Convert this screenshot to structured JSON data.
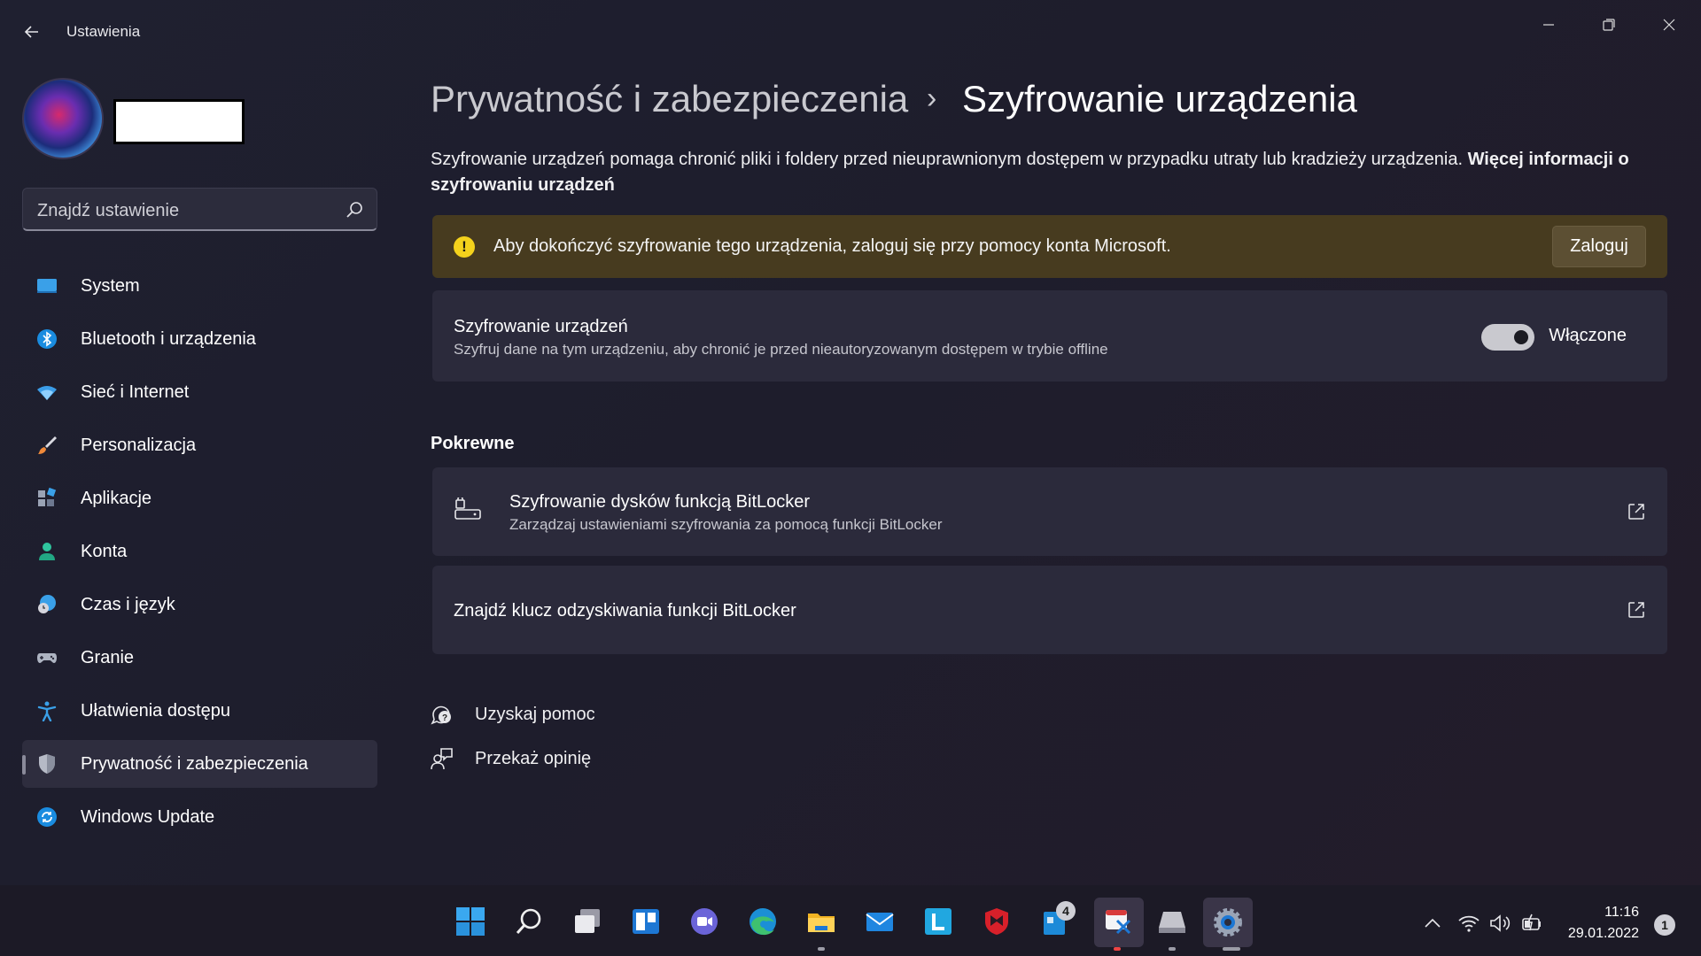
{
  "window": {
    "title": "Ustawienia"
  },
  "sidebar": {
    "search_placeholder": "Znajdź ustawienie",
    "items": [
      {
        "label": "System",
        "icon": "monitor-icon"
      },
      {
        "label": "Bluetooth i urządzenia",
        "icon": "bluetooth-icon"
      },
      {
        "label": "Sieć i Internet",
        "icon": "wifi-icon"
      },
      {
        "label": "Personalizacja",
        "icon": "brush-icon"
      },
      {
        "label": "Aplikacje",
        "icon": "apps-icon"
      },
      {
        "label": "Konta",
        "icon": "person-icon"
      },
      {
        "label": "Czas i język",
        "icon": "globe-clock-icon"
      },
      {
        "label": "Granie",
        "icon": "gamepad-icon"
      },
      {
        "label": "Ułatwienia dostępu",
        "icon": "accessibility-icon"
      },
      {
        "label": "Prywatność i zabezpieczenia",
        "icon": "shield-icon",
        "active": true
      },
      {
        "label": "Windows Update",
        "icon": "update-icon"
      }
    ]
  },
  "main": {
    "breadcrumb_parent": "Prywatność i zabezpieczenia",
    "breadcrumb_separator": "›",
    "breadcrumb_current": "Szyfrowanie urządzenia",
    "description": "Szyfrowanie urządzeń pomaga chronić pliki i foldery przed nieuprawnionym dostępem w przypadku utraty lub kradzieży urządzenia.",
    "description_link": "Więcej informacji o szyfrowaniu urządzeń",
    "warning": {
      "text": "Aby dokończyć szyfrowanie tego urządzenia, zaloguj się przy pomocy konta Microsoft.",
      "button": "Zaloguj",
      "icon_glyph": "!"
    },
    "encryption_card": {
      "title": "Szyfrowanie urządzeń",
      "subtitle": "Szyfruj dane na tym urządzeniu, aby chronić je przed nieautoryzowanym dostępem w trybie offline",
      "toggle_label": "Włączone",
      "toggle_on": true
    },
    "related_title": "Pokrewne",
    "related": [
      {
        "title": "Szyfrowanie dysków funkcją BitLocker",
        "subtitle": "Zarządzaj ustawieniami szyfrowania za pomocą funkcji BitLocker"
      },
      {
        "title": "Znajdź klucz odzyskiwania funkcji BitLocker"
      }
    ],
    "help": {
      "get_help": "Uzyskaj pomoc",
      "feedback": "Przekaż opinię"
    }
  },
  "taskbar": {
    "store_badge": "4",
    "time": "11:16",
    "date": "29.01.2022",
    "notifications": "1",
    "colors": {
      "accent": "#0078d4",
      "warning_bg": "#473b1f",
      "warning_icon": "#f4d21c"
    }
  }
}
